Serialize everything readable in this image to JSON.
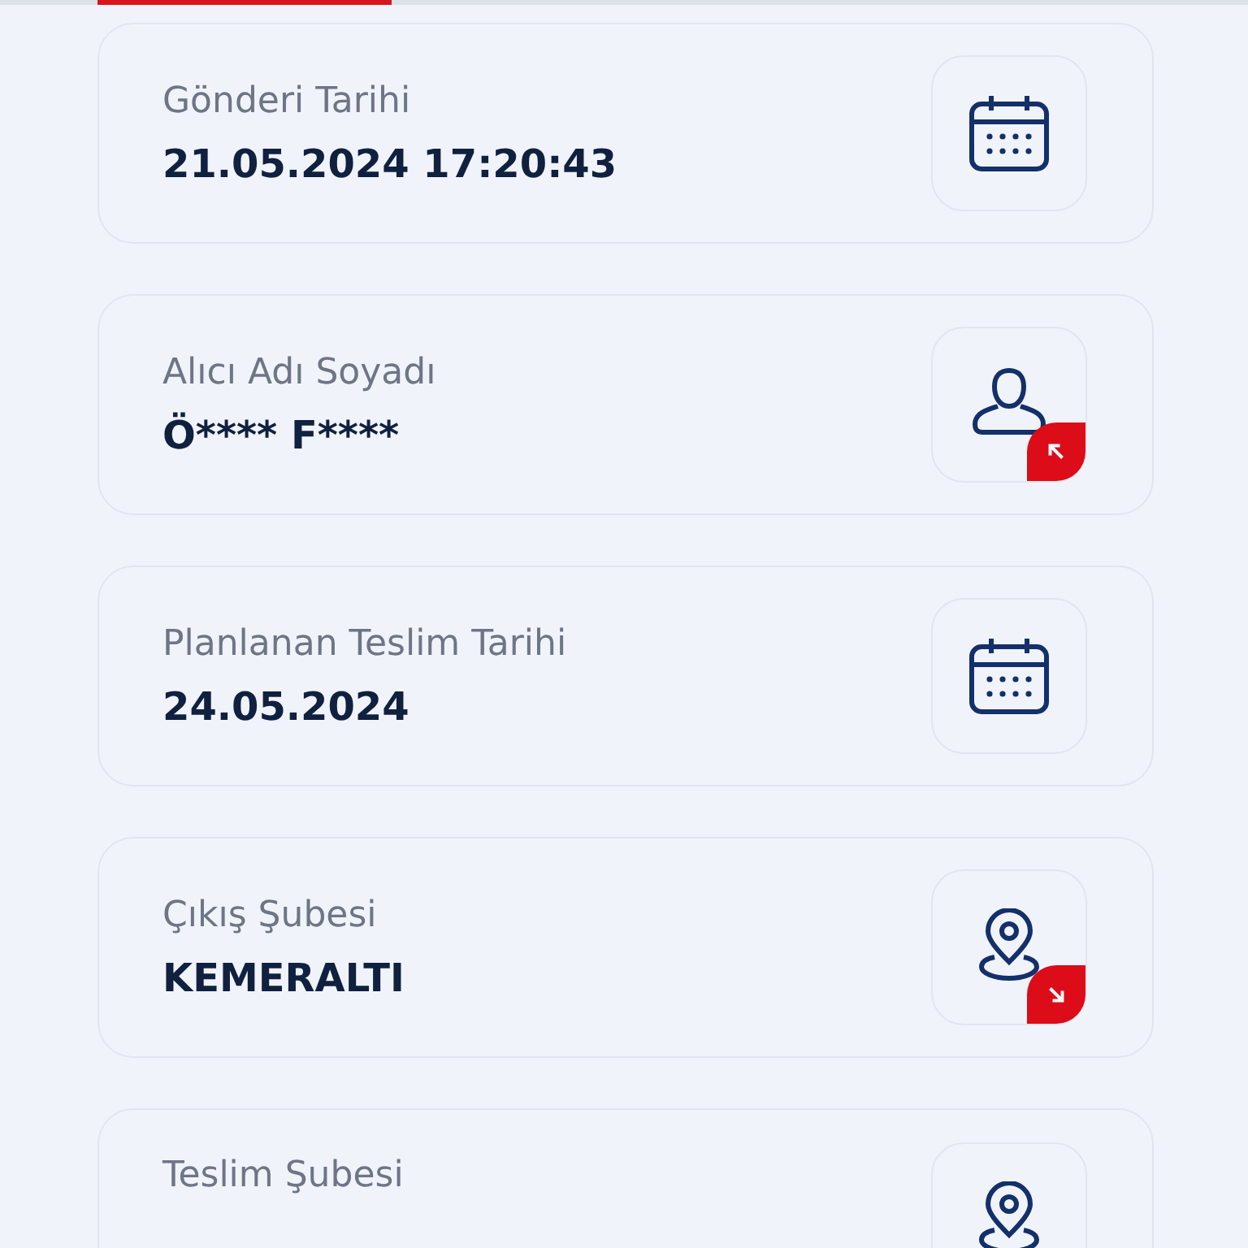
{
  "tab_indicator": {
    "selected": true
  },
  "cards": [
    {
      "kind": "date",
      "label": "Gönderi Tarihi",
      "value": "21.05.2024 17:20:43"
    },
    {
      "kind": "recipient",
      "label": "Alıcı Adı Soyadı",
      "value": "Ö**** F****"
    },
    {
      "kind": "date",
      "label": "Planlanan Teslim Tarihi",
      "value": "24.05.2024"
    },
    {
      "kind": "origin",
      "label": "Çıkış Şubesi",
      "value": "KEMERALTI"
    },
    {
      "kind": "location",
      "label": "Teslim Şubesi"
    }
  ]
}
